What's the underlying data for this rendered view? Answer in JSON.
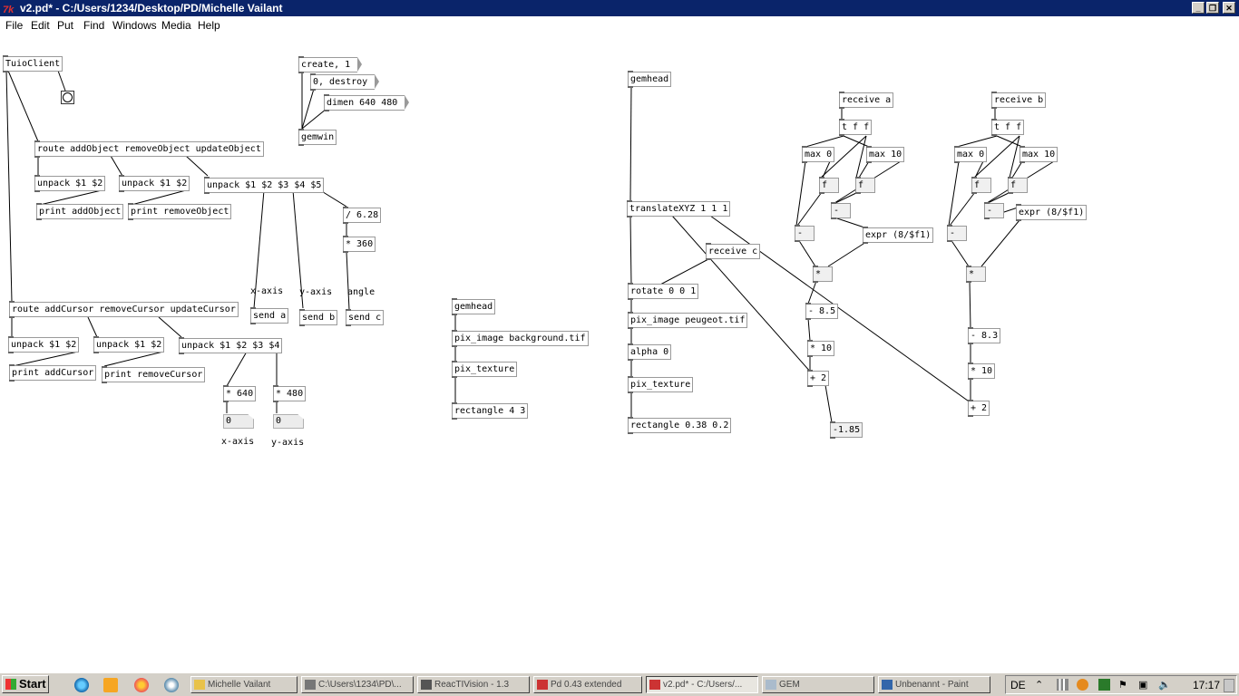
{
  "window": {
    "title": "v2.pd* - C:/Users/1234/Desktop/PD/Michelle Vailant",
    "icon": "tk-icon",
    "buttons": [
      "minimize",
      "restore",
      "close"
    ]
  },
  "menu": [
    "File",
    "Edit",
    "Put",
    "Find",
    "Windows",
    "Media",
    "Help"
  ],
  "patch": {
    "objects": {
      "tuioclient": "TuioClient",
      "route_obj": "route addObject removeObject updateObject",
      "unpack_o1": "unpack $1 $2",
      "unpack_o2": "unpack $1 $2",
      "print_addobj": "print addObject",
      "print_remobj": "print removeObject",
      "unpack_o3": "unpack $1 $2 $3 $4 $5",
      "div628": "/ 6.28",
      "mul360": "* 360",
      "send_a": "send a",
      "send_b": "send b",
      "send_c": "send c",
      "route_cur": "route addCursor removeCursor updateCursor",
      "unpack_c1": "unpack $1 $2",
      "unpack_c2": "unpack $1 $2",
      "print_addcur": "print addCursor",
      "print_remcur": "print removeCursor",
      "unpack_c3": "unpack $1 $2 $3 $4",
      "mul640": "* 640",
      "mul480": "* 480",
      "gemwin": "gemwin",
      "gemhead1": "gemhead",
      "pix_bg": "pix_image background.tif",
      "pix_tex1": "pix_texture",
      "rect43": "rectangle 4 3",
      "gemhead2": "gemhead",
      "translate": "translateXYZ 1 1 1",
      "receive_c": "receive c",
      "rotate": "rotate 0 0 1",
      "pix_peugeot": "pix_image peugeot.tif",
      "alpha": "alpha 0",
      "pix_tex2": "pix_texture",
      "rect038": "rectangle 0.38 0.2",
      "receive_a": "receive a",
      "tff_a": "t f f",
      "max0_a": "max 0",
      "max10_a": "max 10",
      "f1_a": "f",
      "f2_a": "f",
      "minus_a": "-",
      "minus2_a": "-",
      "expr_a": "expr (8/$f1)",
      "mul_a": "*",
      "sub85": "- 8.5",
      "mul10_a": "* 10",
      "add2_a": "+ 2",
      "receive_b": "receive b",
      "tff_b": "t f f",
      "max0_b": "max 0",
      "max10_b": "max 10",
      "f1_b": "f",
      "f2_b": "f",
      "minus_b": "-",
      "minus2_b": "-",
      "expr_b": "expr (8/$f1)",
      "mul_b": "*",
      "sub83": "- 8.3",
      "mul10_b": "* 10",
      "add2_b": "+ 2",
      "num185": "-1.85"
    },
    "messages": {
      "create": "create, 1",
      "destroy": "0, destroy",
      "dimen": "dimen 640 480"
    },
    "atoms": {
      "xval": "0",
      "yval": "0"
    },
    "comments": {
      "xaxis1": "x-axis",
      "yaxis1": "y-axis",
      "angle": "angle",
      "xaxis2": "x-axis",
      "yaxis2": "y-axis"
    }
  },
  "taskbar": {
    "start": "Start",
    "buttons": [
      "Michelle Vailant",
      "C:\\Users\\1234\\PD\\...",
      "ReacTIVision - 1.3",
      "Pd 0.43 extended",
      "v2.pd* - C:/Users/...",
      "GEM",
      "Unbenannt - Paint"
    ],
    "language": "DE",
    "clock": "17:17"
  }
}
